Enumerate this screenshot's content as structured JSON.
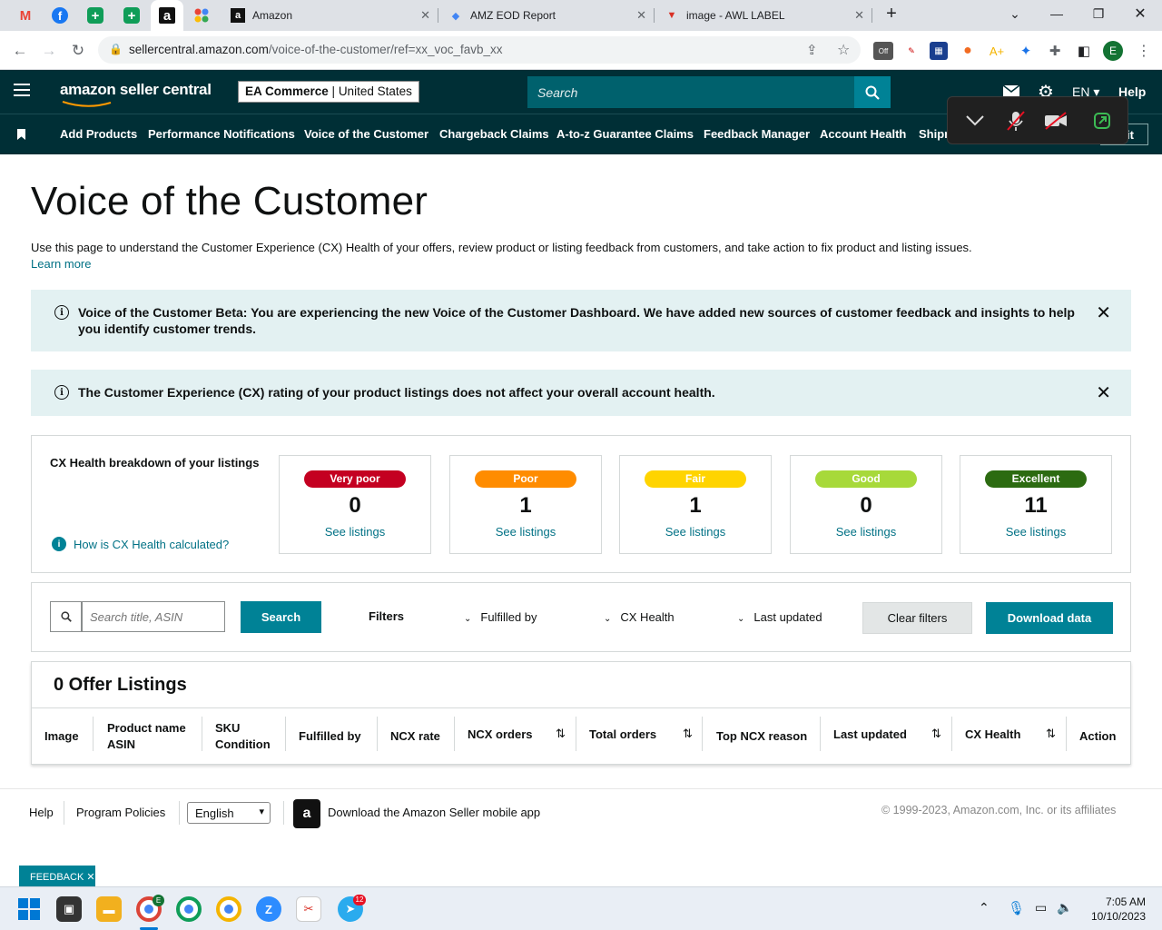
{
  "browser": {
    "tabs": [
      {
        "label": "Amazon"
      },
      {
        "label": "AMZ EOD Report"
      },
      {
        "label": "image - AWL LABEL"
      }
    ],
    "url_host": "sellercentral.amazon.com",
    "url_path": "/voice-of-the-customer/ref=xx_voc_favb_xx",
    "profile_initial": "E",
    "ext_badge": "Off"
  },
  "header": {
    "logo": "amazon seller central",
    "store_name": "EA Commerce",
    "store_region": "United States",
    "search_placeholder": "Search",
    "language": "EN",
    "help": "Help"
  },
  "nav": {
    "items": [
      "Add Products",
      "Performance Notifications",
      "Voice of the Customer",
      "Chargeback Claims",
      "A-to-z Guarantee Claims",
      "Feedback Manager",
      "Account Health",
      "Shipr"
    ],
    "edit_partial": "it"
  },
  "page": {
    "title": "Voice of the Customer",
    "description": "Use this page to understand the Customer Experience (CX) Health of your offers, review product or listing feedback from customers, and take action to fix product and listing issues.",
    "learn_more": "Learn more"
  },
  "alerts": [
    {
      "text": "Voice of the Customer Beta: You are experiencing the new Voice of the Customer Dashboard. We have added new sources of customer feedback and insights to help you identify customer trends."
    },
    {
      "text": "The Customer Experience (CX) rating of your product listings does not affect your overall account health."
    }
  ],
  "cx_health": {
    "title": "CX Health breakdown of your listings",
    "help_link": "How is CX Health calculated?",
    "cards": [
      {
        "label": "Very poor",
        "count": "0",
        "link": "See listings",
        "color": "#c40021",
        "text_color": "#ffffff"
      },
      {
        "label": "Poor",
        "count": "1",
        "link": "See listings",
        "color": "#ff8c00",
        "text_color": "#ffffff"
      },
      {
        "label": "Fair",
        "count": "1",
        "link": "See listings",
        "color": "#ffd400",
        "text_color": "#ffffff"
      },
      {
        "label": "Good",
        "count": "0",
        "link": "See listings",
        "color": "#a7d93a",
        "text_color": "#ffffff"
      },
      {
        "label": "Excellent",
        "count": "11",
        "link": "See listings",
        "color": "#2c6b11",
        "text_color": "#ffffff"
      }
    ]
  },
  "filters": {
    "search_placeholder": "Search title, ASIN",
    "search_button": "Search",
    "label": "Filters",
    "fulfilled_by": "Fulfilled by",
    "cx_health": "CX Health",
    "last_updated": "Last updated",
    "clear": "Clear filters",
    "download": "Download data"
  },
  "listings": {
    "title": "0 Offer Listings",
    "columns": {
      "image": "Image",
      "product_name": "Product name",
      "asin": "ASIN",
      "sku": "SKU",
      "condition": "Condition",
      "fulfilled_by": "Fulfilled by",
      "ncx_rate": "NCX rate",
      "ncx_orders": "NCX orders",
      "total_orders": "Total orders",
      "top_reason": "Top NCX reason",
      "last_updated": "Last updated",
      "cx_health": "CX Health",
      "action": "Action"
    }
  },
  "footer": {
    "help": "Help",
    "policies": "Program Policies",
    "language": "English",
    "app": "Download the Amazon Seller mobile app",
    "copyright": "© 1999-2023, Amazon.com, Inc. or its affiliates",
    "feedback": "FEEDBACK"
  },
  "taskbar": {
    "time": "7:05 AM",
    "date": "10/10/2023",
    "telegram_badge": "12",
    "chrome_badge": "E"
  },
  "colors": {
    "header_bg": "#002f36",
    "teal_button": "#008296",
    "link": "#007185",
    "alert_bg": "#e3f1f2"
  }
}
